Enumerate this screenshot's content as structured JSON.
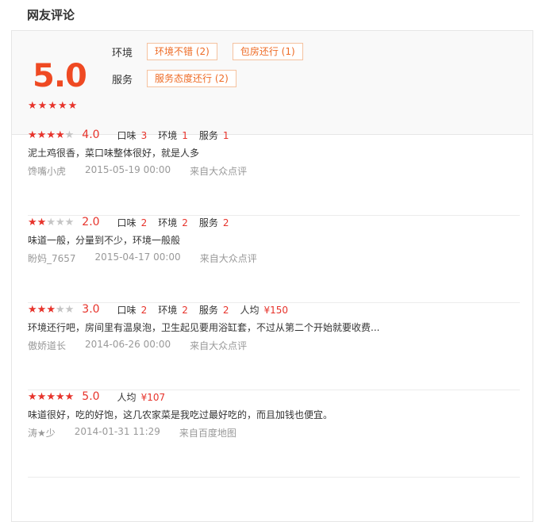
{
  "section_title": "网友评论",
  "summary": {
    "score": "5.0",
    "stars": 5,
    "rows": [
      {
        "label": "环境",
        "tags": [
          "环境不错 (2)",
          "包房还行 (1)"
        ]
      },
      {
        "label": "服务",
        "tags": [
          "服务态度还行 (2)"
        ]
      }
    ]
  },
  "reviews": [
    {
      "stars": 4,
      "rating": "4.0",
      "subs": [
        {
          "label": "口味",
          "value": "3"
        },
        {
          "label": "环境",
          "value": "1"
        },
        {
          "label": "服务",
          "value": "1"
        }
      ],
      "text": "泥土鸡很香，菜口味整体很好，就是人多",
      "user": "馋嘴小虎",
      "date": "2015-05-19 00:00",
      "source": "来自大众点评"
    },
    {
      "stars": 2,
      "rating": "2.0",
      "subs": [
        {
          "label": "口味",
          "value": "2"
        },
        {
          "label": "环境",
          "value": "2"
        },
        {
          "label": "服务",
          "value": "2"
        }
      ],
      "text": "味道一般，分量到不少，环境一般般",
      "user": "盼妈_7657",
      "date": "2015-04-17 00:00",
      "source": "来自大众点评"
    },
    {
      "stars": 3,
      "rating": "3.0",
      "subs": [
        {
          "label": "口味",
          "value": "2"
        },
        {
          "label": "环境",
          "value": "2"
        },
        {
          "label": "服务",
          "value": "2"
        },
        {
          "label": "人均",
          "value": "¥150"
        }
      ],
      "text": "环境还行吧，房间里有温泉泡，卫生起见要用浴缸套，不过从第二个开始就要收费...",
      "user": "傲娇道长",
      "date": "2014-06-26 00:00",
      "source": "来自大众点评"
    },
    {
      "stars": 5,
      "rating": "5.0",
      "subs": [
        {
          "label": "人均",
          "value": "¥107"
        }
      ],
      "text": "味道很好，吃的好饱，这几农家菜是我吃过最好吃的，而且加钱也便宜。",
      "user": "涛★少",
      "date": "2014-01-31 11:29",
      "source": "来自百度地图"
    }
  ]
}
